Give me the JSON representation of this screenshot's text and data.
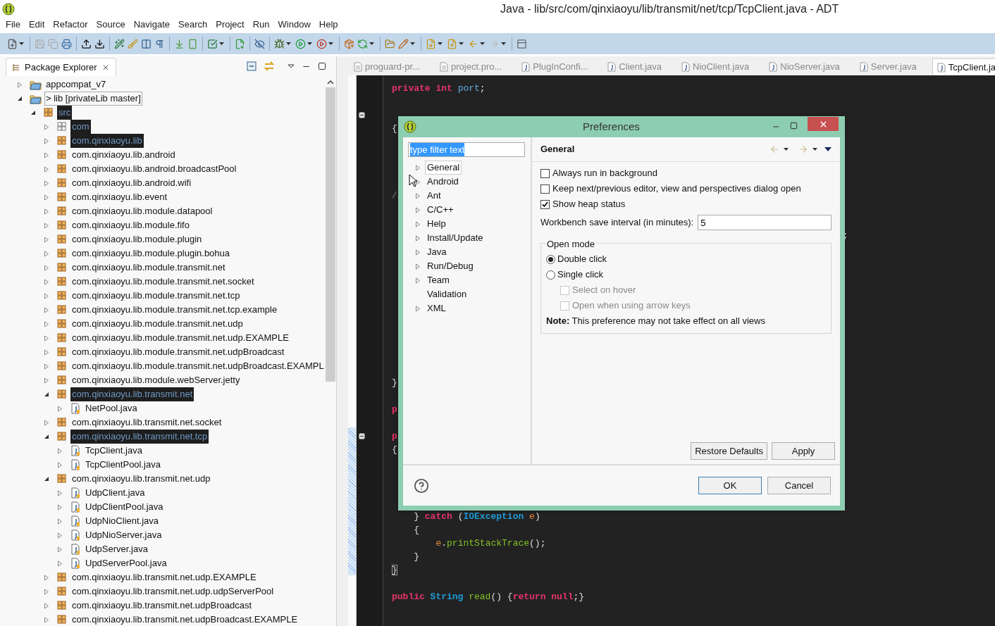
{
  "window": {
    "title": "Java - lib/src/com/qinxiaoyu/lib/transmit/net/tcp/TcpClient.java - ADT"
  },
  "menu": [
    "File",
    "Edit",
    "Refactor",
    "Source",
    "Navigate",
    "Search",
    "Project",
    "Run",
    "Window",
    "Help"
  ],
  "package_explorer": {
    "title": "Package Explorer",
    "tree": [
      {
        "label": "appcompat_v7",
        "kind": "project",
        "expanded": false,
        "selected": false,
        "focused": false
      },
      {
        "label": "> lib  [privateLib master]",
        "kind": "project",
        "expanded": true,
        "selected": false,
        "focused": true,
        "children": [
          {
            "label": "src",
            "kind": "source",
            "expanded": true,
            "selected": true,
            "focused": false,
            "children": [
              {
                "label": "com",
                "kind": "empty-package",
                "expanded": false,
                "selected": true,
                "focused": false
              },
              {
                "label": "com.qinxiaoyu.lib",
                "kind": "package",
                "expanded": false,
                "selected": true,
                "focused": false
              },
              {
                "label": "com.qinxiaoyu.lib.android",
                "kind": "package",
                "expanded": false,
                "selected": false,
                "focused": false
              },
              {
                "label": "com.qinxiaoyu.lib.android.broadcastPool",
                "kind": "package",
                "expanded": false,
                "selected": false,
                "focused": false
              },
              {
                "label": "com.qinxiaoyu.lib.android.wifi",
                "kind": "package",
                "expanded": false,
                "selected": false,
                "focused": false
              },
              {
                "label": "com.qinxiaoyu.lib.event",
                "kind": "package",
                "expanded": false,
                "selected": false,
                "focused": false
              },
              {
                "label": "com.qinxiaoyu.lib.module.datapool",
                "kind": "package",
                "expanded": false,
                "selected": false,
                "focused": false
              },
              {
                "label": "com.qinxiaoyu.lib.module.fifo",
                "kind": "package",
                "expanded": false,
                "selected": false,
                "focused": false
              },
              {
                "label": "com.qinxiaoyu.lib.module.plugin",
                "kind": "package",
                "expanded": false,
                "selected": false,
                "focused": false
              },
              {
                "label": "com.qinxiaoyu.lib.module.plugin.bohua",
                "kind": "package",
                "expanded": false,
                "selected": false,
                "focused": false
              },
              {
                "label": "com.qinxiaoyu.lib.module.transmit.net",
                "kind": "package",
                "expanded": false,
                "selected": false,
                "focused": false
              },
              {
                "label": "com.qinxiaoyu.lib.module.transmit.net.socket",
                "kind": "package",
                "expanded": false,
                "selected": false,
                "focused": false
              },
              {
                "label": "com.qinxiaoyu.lib.module.transmit.net.tcp",
                "kind": "package",
                "expanded": false,
                "selected": false,
                "focused": false
              },
              {
                "label": "com.qinxiaoyu.lib.module.transmit.net.tcp.example",
                "kind": "package",
                "expanded": false,
                "selected": false,
                "focused": false
              },
              {
                "label": "com.qinxiaoyu.lib.module.transmit.net.udp",
                "kind": "package",
                "expanded": false,
                "selected": false,
                "focused": false
              },
              {
                "label": "com.qinxiaoyu.lib.module.transmit.net.udp.EXAMPLE",
                "kind": "package",
                "expanded": false,
                "selected": false,
                "focused": false
              },
              {
                "label": "com.qinxiaoyu.lib.module.transmit.net.udpBroadcast",
                "kind": "package",
                "expanded": false,
                "selected": false,
                "focused": false
              },
              {
                "label": "com.qinxiaoyu.lib.module.transmit.net.udpBroadcast.EXAMPL",
                "kind": "package",
                "expanded": false,
                "selected": false,
                "focused": false
              },
              {
                "label": "com.qinxiaoyu.lib.module.webServer.jetty",
                "kind": "package",
                "expanded": false,
                "selected": false,
                "focused": false
              },
              {
                "label": "com.qinxiaoyu.lib.transmit.net",
                "kind": "package",
                "expanded": true,
                "selected": true,
                "focused": false,
                "children": [
                  {
                    "label": "NetPool.java",
                    "kind": "file",
                    "expanded": false,
                    "selected": false,
                    "focused": false
                  }
                ]
              },
              {
                "label": "com.qinxiaoyu.lib.transmit.net.socket",
                "kind": "package",
                "expanded": false,
                "selected": false,
                "focused": false
              },
              {
                "label": "com.qinxiaoyu.lib.transmit.net.tcp",
                "kind": "package",
                "expanded": true,
                "selected": true,
                "focused": false,
                "children": [
                  {
                    "label": "TcpClient.java",
                    "kind": "file",
                    "expanded": false,
                    "selected": false,
                    "focused": false
                  },
                  {
                    "label": "TcpClientPool.java",
                    "kind": "file",
                    "expanded": false,
                    "selected": false,
                    "focused": false
                  }
                ]
              },
              {
                "label": "com.qinxiaoyu.lib.transmit.net.udp",
                "kind": "package",
                "expanded": true,
                "selected": false,
                "focused": false,
                "children": [
                  {
                    "label": "UdpClient.java",
                    "kind": "file",
                    "expanded": false,
                    "selected": false,
                    "focused": false
                  },
                  {
                    "label": "UdpClientPool.java",
                    "kind": "file",
                    "expanded": false,
                    "selected": false,
                    "focused": false
                  },
                  {
                    "label": "UdpNioClient.java",
                    "kind": "file",
                    "expanded": false,
                    "selected": false,
                    "focused": false
                  },
                  {
                    "label": "UdpNioServer.java",
                    "kind": "file",
                    "expanded": false,
                    "selected": false,
                    "focused": false
                  },
                  {
                    "label": "UdpServer.java",
                    "kind": "file",
                    "expanded": false,
                    "selected": false,
                    "focused": false
                  },
                  {
                    "label": "UpdServerPool.java",
                    "kind": "file",
                    "expanded": false,
                    "selected": false,
                    "focused": false
                  }
                ]
              },
              {
                "label": "com.qinxiaoyu.lib.transmit.net.udp.EXAMPLE",
                "kind": "package",
                "expanded": false,
                "selected": false,
                "focused": false
              },
              {
                "label": "com.qinxiaoyu.lib.transmit.net.udp.udpServerPool",
                "kind": "package",
                "expanded": false,
                "selected": false,
                "focused": false
              },
              {
                "label": "com.qinxiaoyu.lib.transmit.net.udpBroadcast",
                "kind": "package",
                "expanded": false,
                "selected": false,
                "focused": false
              },
              {
                "label": "com.qinxiaoyu.lib.transmit.net.udpBroadcast.EXAMPLE",
                "kind": "package",
                "expanded": false,
                "selected": false,
                "focused": false
              }
            ]
          }
        ]
      }
    ]
  },
  "editor": {
    "tabs": [
      {
        "label": "proguard-pr...",
        "kind": "text",
        "selected": false
      },
      {
        "label": "project.pro...",
        "kind": "text",
        "selected": false
      },
      {
        "label": "PlugInConfi...",
        "kind": "java",
        "selected": false
      },
      {
        "label": "Client.java",
        "kind": "java",
        "selected": false
      },
      {
        "label": "NioClient.java",
        "kind": "java",
        "selected": false
      },
      {
        "label": "NioServer.java",
        "kind": "java",
        "selected": false
      },
      {
        "label": "Server.java",
        "kind": "java",
        "selected": false
      },
      {
        "label": "TcpClient.ja",
        "kind": "java",
        "selected": true
      }
    ],
    "lines": [
      {
        "kind": "code",
        "tokens": [
          {
            "text": "private ",
            "kind": "keyword"
          },
          {
            "text": "int ",
            "kind": "keyword"
          },
          {
            "text": "port",
            "kind": "field"
          },
          {
            "text": ";",
            "kind": "plain"
          }
        ]
      },
      {
        "kind": "blank"
      },
      {
        "kind": "blank",
        "fold": true
      },
      {
        "kind": "code",
        "tokens": [
          {
            "text": "{",
            "kind": "plain"
          }
        ]
      },
      {
        "kind": "blank"
      },
      {
        "kind": "blank"
      },
      {
        "kind": "blank"
      },
      {
        "kind": "blank"
      },
      {
        "kind": "code",
        "tokens": [
          {
            "text": "//",
            "kind": "comment"
          }
        ]
      },
      {
        "kind": "blank"
      },
      {
        "kind": "blank"
      },
      {
        "kind": "code",
        "tokens": [
          {
            "text": ";",
            "kind": "far"
          }
        ]
      },
      {
        "kind": "blank"
      },
      {
        "kind": "blank"
      },
      {
        "kind": "blank"
      },
      {
        "kind": "blank"
      },
      {
        "kind": "blank"
      },
      {
        "kind": "blank"
      },
      {
        "kind": "blank"
      },
      {
        "kind": "blank"
      },
      {
        "kind": "blank"
      },
      {
        "kind": "blank"
      },
      {
        "kind": "code",
        "tokens": [
          {
            "text": "}",
            "kind": "plain"
          }
        ]
      },
      {
        "kind": "blank"
      },
      {
        "kind": "code",
        "tokens": [
          {
            "text": "p",
            "kind": "keyword"
          }
        ]
      },
      {
        "kind": "blank"
      },
      {
        "kind": "code",
        "fold": true,
        "tokens": [
          {
            "text": "p",
            "kind": "keyword"
          }
        ]
      },
      {
        "kind": "code",
        "tokens": [
          {
            "text": "{",
            "kind": "plain"
          }
        ]
      },
      {
        "kind": "blank"
      },
      {
        "kind": "blank"
      },
      {
        "kind": "blank"
      },
      {
        "kind": "blank"
      },
      {
        "kind": "code",
        "tokens": [
          {
            "text": "    } ",
            "kind": "plain"
          },
          {
            "text": "catch",
            "kind": "keyword"
          },
          {
            "text": " (",
            "kind": "plain"
          },
          {
            "text": "IOException",
            "kind": "type"
          },
          {
            "text": " e",
            "kind": "variable"
          },
          {
            "text": ")",
            "kind": "plain"
          }
        ]
      },
      {
        "kind": "code",
        "tokens": [
          {
            "text": "    {",
            "kind": "plain"
          }
        ]
      },
      {
        "kind": "code",
        "tokens": [
          {
            "text": "        e",
            "kind": "variable"
          },
          {
            "text": ".",
            "kind": "plain"
          },
          {
            "text": "printStackTrace",
            "kind": "method"
          },
          {
            "text": "();",
            "kind": "plain"
          }
        ]
      },
      {
        "kind": "code",
        "tokens": [
          {
            "text": "    }",
            "kind": "plain"
          }
        ]
      },
      {
        "kind": "code",
        "tokens": [
          {
            "text": "}",
            "kind": "matched"
          }
        ]
      },
      {
        "kind": "blank"
      },
      {
        "kind": "code",
        "tokens": [
          {
            "text": "public ",
            "kind": "keyword"
          },
          {
            "text": "String ",
            "kind": "type"
          },
          {
            "text": "read",
            "kind": "method"
          },
          {
            "text": "() {",
            "kind": "plain"
          },
          {
            "text": "return ",
            "kind": "keyword"
          },
          {
            "text": "null",
            "kind": "keyword"
          },
          {
            "text": ";}",
            "kind": "plain"
          }
        ]
      }
    ]
  },
  "dialog": {
    "title": "Preferences",
    "filter": {
      "value": "type filter text",
      "selected": true
    },
    "categories": [
      {
        "label": "General",
        "has_children": true,
        "selected": true
      },
      {
        "label": "Android",
        "has_children": true,
        "selected": false
      },
      {
        "label": "Ant",
        "has_children": true,
        "selected": false
      },
      {
        "label": "C/C++",
        "has_children": true,
        "selected": false
      },
      {
        "label": "Help",
        "has_children": true,
        "selected": false
      },
      {
        "label": "Install/Update",
        "has_children": true,
        "selected": false
      },
      {
        "label": "Java",
        "has_children": true,
        "selected": false
      },
      {
        "label": "Run/Debug",
        "has_children": true,
        "selected": false
      },
      {
        "label": "Team",
        "has_children": true,
        "selected": false
      },
      {
        "label": "Validation",
        "has_children": false,
        "selected": false
      },
      {
        "label": "XML",
        "has_children": true,
        "selected": false
      }
    ],
    "page_title": "General",
    "options": [
      {
        "label": "Always run in background",
        "checked": false
      },
      {
        "label": "Keep next/previous editor, view and perspectives dialog open",
        "checked": false
      },
      {
        "label": "Show heap status",
        "checked": true
      }
    ],
    "save_interval": {
      "label": "Workbench save interval (in minutes):",
      "value": "5"
    },
    "open_mode": {
      "title": "Open mode",
      "radios": [
        {
          "label": "Double click",
          "selected": true
        },
        {
          "label": "Single click",
          "selected": false
        }
      ],
      "suboptions": [
        {
          "label": "Select on hover",
          "checked": false,
          "disabled": true
        },
        {
          "label": "Open when using arrow keys",
          "checked": false,
          "disabled": true
        }
      ],
      "note": "**Note:** This preference may not take effect on all views"
    },
    "page_buttons": [
      "Restore Defaults",
      "Apply"
    ],
    "buttons": [
      {
        "label": "OK",
        "default": true
      },
      {
        "label": "Cancel",
        "default": false
      }
    ]
  }
}
